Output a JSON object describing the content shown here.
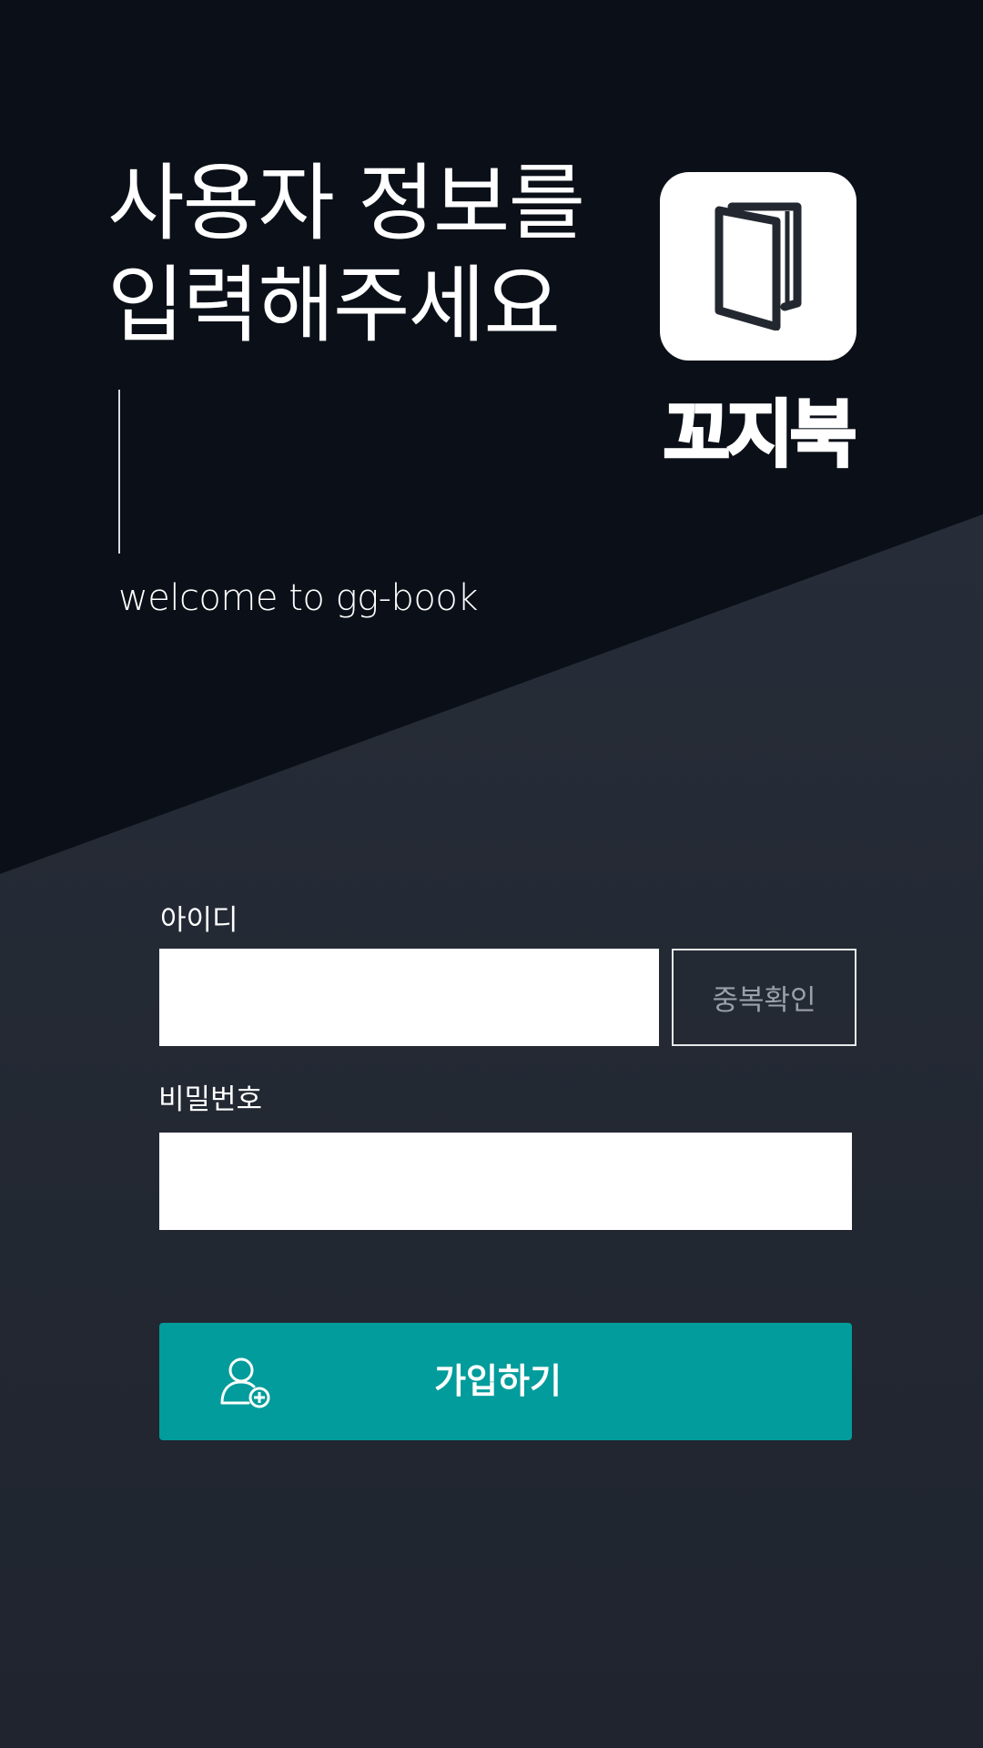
{
  "header": {
    "title_line1": "사용자 정보를",
    "title_line2": "입력해주세요",
    "welcome": "welcome to gg-book"
  },
  "brand": {
    "name": "꼬지북",
    "logo_icon": "book-icon"
  },
  "form": {
    "id_label": "아이디",
    "id_value": "",
    "id_placeholder": "",
    "duplicate_check_label": "중복확인",
    "password_label": "비밀번호",
    "password_value": "",
    "password_placeholder": "",
    "submit_label": "가입하기",
    "submit_icon": "user-add-icon"
  },
  "colors": {
    "background_top": "#0b1018",
    "background_bottom": "#222833",
    "accent": "#019c9b",
    "input_background": "#ffffff"
  }
}
